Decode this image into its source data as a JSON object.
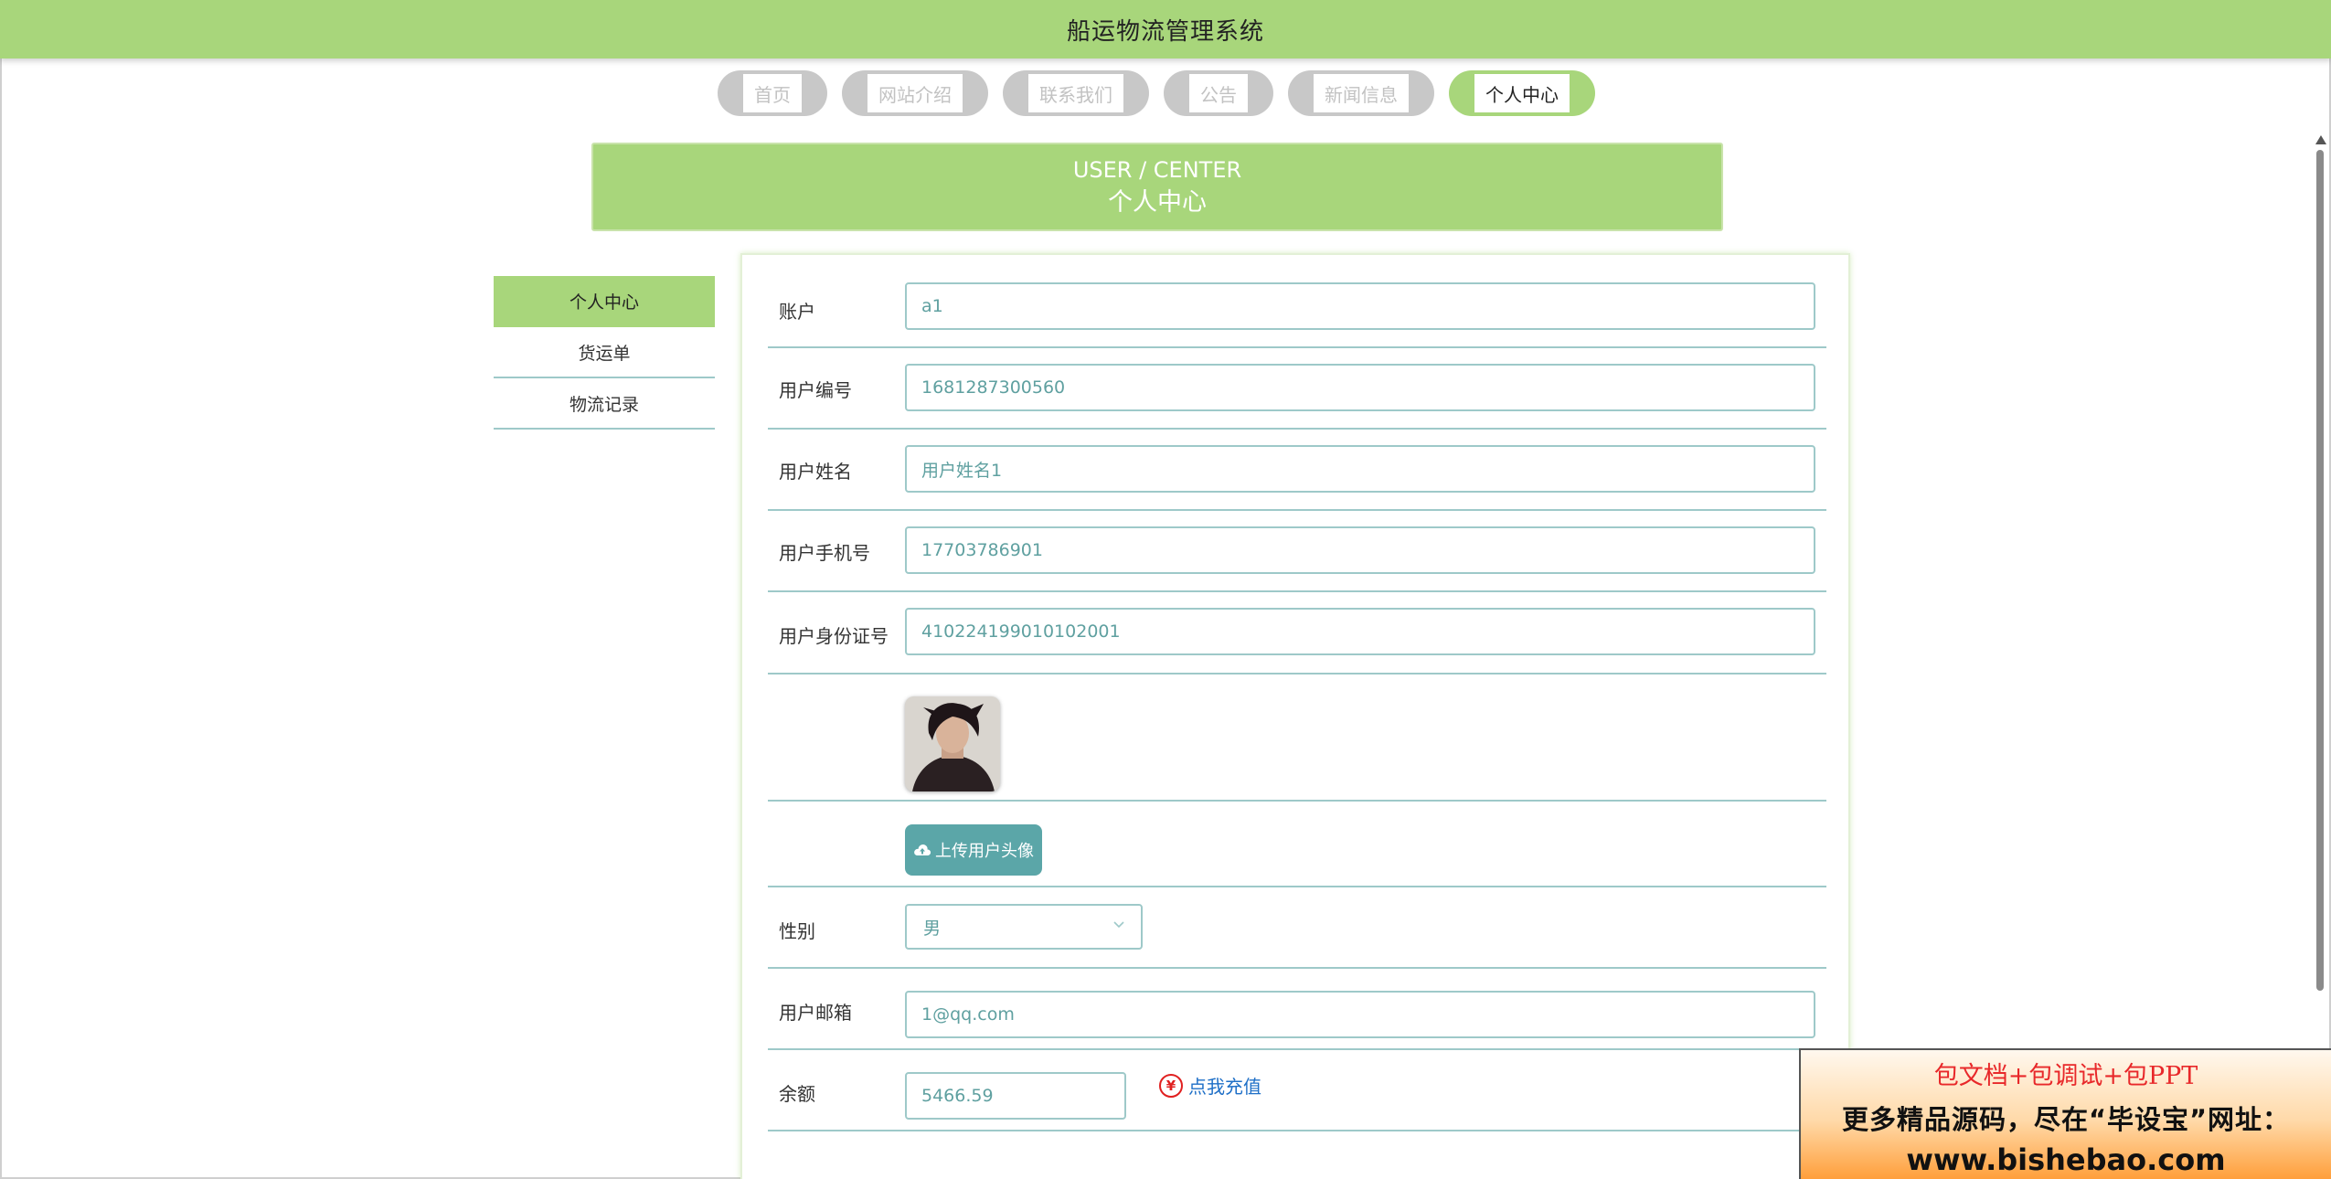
{
  "header": {
    "title": "船运物流管理系统"
  },
  "nav": {
    "items": [
      {
        "label": "首页",
        "active": false
      },
      {
        "label": "网站介绍",
        "active": false
      },
      {
        "label": "联系我们",
        "active": false
      },
      {
        "label": "公告",
        "active": false
      },
      {
        "label": "新闻信息",
        "active": false
      },
      {
        "label": "个人中心",
        "active": true
      }
    ]
  },
  "banner": {
    "en": "USER / CENTER",
    "cn": "个人中心"
  },
  "sidebar": {
    "items": [
      {
        "label": "个人中心",
        "active": true
      },
      {
        "label": "货运单",
        "active": false
      },
      {
        "label": "物流记录",
        "active": false
      }
    ]
  },
  "form": {
    "account": {
      "label": "账户",
      "value": "a1"
    },
    "user_no": {
      "label": "用户编号",
      "value": "1681287300560"
    },
    "user_name": {
      "label": "用户姓名",
      "value": "用户姓名1"
    },
    "phone": {
      "label": "用户手机号",
      "value": "17703786901"
    },
    "id_card": {
      "label": "用户身份证号",
      "value": "410224199010102001"
    },
    "upload": {
      "label": "上传用户头像",
      "icon": "cloud-upload-icon"
    },
    "gender": {
      "label": "性别",
      "value": "男"
    },
    "email": {
      "label": "用户邮箱",
      "value": "1@qq.com"
    },
    "balance": {
      "label": "余额",
      "value": "5466.59",
      "recharge_label": "点我充值",
      "icon": "yen-icon"
    }
  },
  "ad": {
    "line1": "包文档+包调试+包PPT",
    "line2": "更多精品源码，尽在“毕设宝”网址：",
    "line3": "www.bishebao.com"
  },
  "colors": {
    "accent": "#a8d67b",
    "border": "#9ec9c9",
    "button": "#5ba6a8",
    "link": "#1e6fc7"
  }
}
